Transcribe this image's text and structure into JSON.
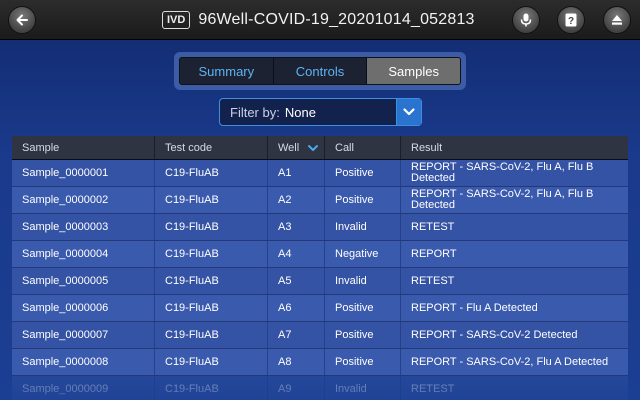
{
  "header": {
    "badge": "IVD",
    "title": "96Well-COVID-19_20201014_052813",
    "icons": [
      "back-arrow-icon",
      "microphone-icon",
      "help-icon",
      "eject-icon"
    ]
  },
  "tabs": [
    {
      "label": "Summary",
      "active": false
    },
    {
      "label": "Controls",
      "active": false
    },
    {
      "label": "Samples",
      "active": true
    }
  ],
  "filter": {
    "label": "Filter by:",
    "value": "None"
  },
  "table": {
    "columns": [
      "Sample",
      "Test code",
      "Well",
      "Call",
      "Result"
    ],
    "sort_column": "Well",
    "rows": [
      {
        "sample": "Sample_0000001",
        "test": "C19-FluAB",
        "well": "A1",
        "call": "Positive",
        "result": "REPORT - SARS-CoV-2, Flu A, Flu B Detected"
      },
      {
        "sample": "Sample_0000002",
        "test": "C19-FluAB",
        "well": "A2",
        "call": "Positive",
        "result": "REPORT - SARS-CoV-2, Flu A, Flu B Detected"
      },
      {
        "sample": "Sample_0000003",
        "test": "C19-FluAB",
        "well": "A3",
        "call": "Invalid",
        "result": "RETEST"
      },
      {
        "sample": "Sample_0000004",
        "test": "C19-FluAB",
        "well": "A4",
        "call": "Negative",
        "result": "REPORT"
      },
      {
        "sample": "Sample_0000005",
        "test": "C19-FluAB",
        "well": "A5",
        "call": "Invalid",
        "result": "RETEST"
      },
      {
        "sample": "Sample_0000006",
        "test": "C19-FluAB",
        "well": "A6",
        "call": "Positive",
        "result": "REPORT - Flu A Detected"
      },
      {
        "sample": "Sample_0000007",
        "test": "C19-FluAB",
        "well": "A7",
        "call": "Positive",
        "result": "REPORT - SARS-CoV-2 Detected"
      },
      {
        "sample": "Sample_0000008",
        "test": "C19-FluAB",
        "well": "A8",
        "call": "Positive",
        "result": "REPORT - SARS-CoV-2, Flu A Detected"
      },
      {
        "sample": "Sample_0000009",
        "test": "C19-FluAB",
        "well": "A9",
        "call": "Invalid",
        "result": "RETEST"
      }
    ]
  }
}
